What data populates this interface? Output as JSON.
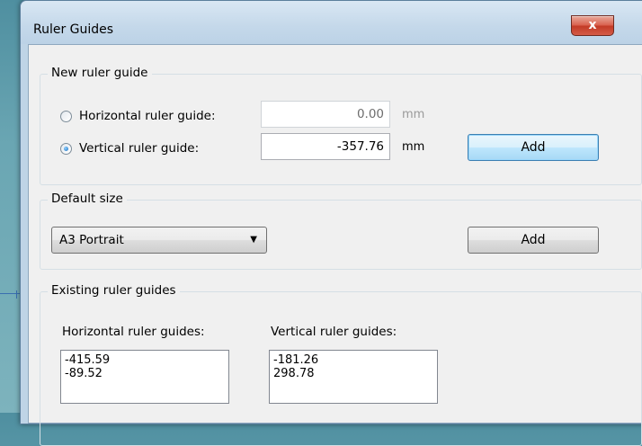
{
  "dialog": {
    "title": "Ruler Guides",
    "close_glyph": "x"
  },
  "new_guide": {
    "legend": "New ruler guide",
    "horizontal": {
      "label": "Horizontal ruler guide:",
      "value": "0.00",
      "unit": "mm",
      "selected": false
    },
    "vertical": {
      "label": "Vertical ruler guide:",
      "value": "-357.76",
      "unit": "mm",
      "selected": true
    },
    "add_label": "Add"
  },
  "default_size": {
    "legend": "Default size",
    "selected": "A3 Portrait",
    "add_label": "Add"
  },
  "existing": {
    "legend": "Existing ruler guides",
    "horizontal_label": "Horizontal ruler guides:",
    "vertical_label": "Vertical ruler guides:",
    "horizontal_items": [
      "-415.59",
      "-89.52"
    ],
    "vertical_items": [
      "-181.26",
      "298.78"
    ]
  }
}
